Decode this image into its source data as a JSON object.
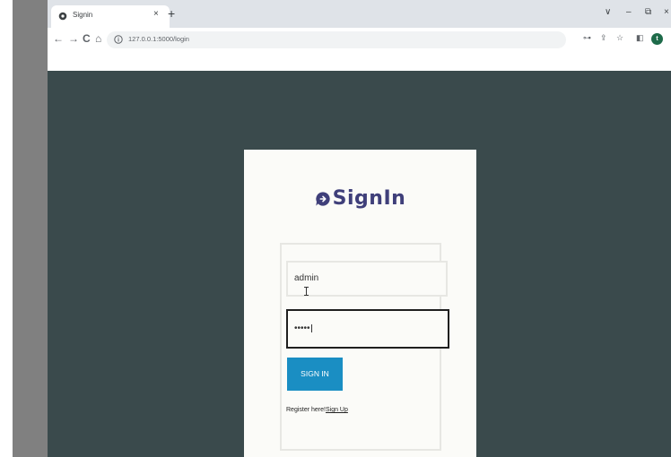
{
  "browser": {
    "tab_title": "Signin",
    "tab_close": "×",
    "new_tab": "+",
    "url": "127.0.0.1:5000/login",
    "window_controls": {
      "tab_search": "∨",
      "minimize": "–",
      "restore": "⧉",
      "close": "×"
    },
    "nav": {
      "back": "←",
      "forward": "→",
      "reload": "C",
      "home": "⌂"
    },
    "toolbar_icons": {
      "key": "⊶",
      "share": "⇪",
      "star": "☆",
      "sidepanel": "◧"
    },
    "profile_initial": "t",
    "icons": [
      "favicon-icon",
      "info-icon",
      "key-icon",
      "share-icon",
      "star-icon",
      "sidepanel-icon"
    ]
  },
  "login": {
    "title": "SignIn",
    "title_icon": "sign-in-icon",
    "username_value": "admin",
    "password_value": "•••••",
    "submit_label": "SIGN IN",
    "register_prefix": "Register here!",
    "register_link": "Sign Up"
  },
  "colors": {
    "page_background": "#3a4a4c",
    "card_background": "#fbfbf8",
    "title_color": "#3f3f7a",
    "button_color": "#1a8ec3",
    "side_pane": "#808080"
  }
}
